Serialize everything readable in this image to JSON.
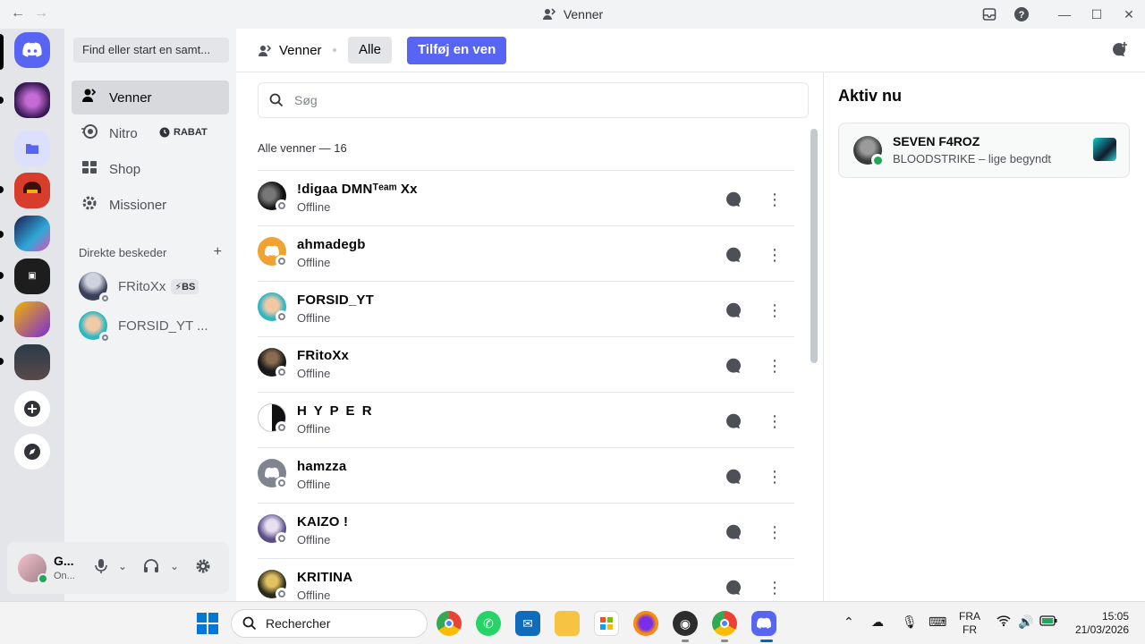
{
  "window": {
    "title": "Venner",
    "back_icon": "arrow-left-icon",
    "forward_icon": "arrow-right-icon"
  },
  "sidebar": {
    "find_placeholder": "Find eller start en samt...",
    "nav": [
      {
        "label": "Venner",
        "icon": "friends-icon",
        "active": true
      },
      {
        "label": "Nitro",
        "icon": "nitro-icon"
      },
      {
        "label": "Shop",
        "icon": "shop-icon"
      },
      {
        "label": "Missioner",
        "icon": "missions-icon"
      }
    ],
    "nitro_badge": "RABAT",
    "dm_header": "Direkte beskeder",
    "dms": [
      {
        "name": "FRitoXx",
        "badge": "BS"
      },
      {
        "name": "FORSID_YT ..."
      }
    ]
  },
  "user_panel": {
    "name": "G...",
    "status": "On..."
  },
  "topbar": {
    "venner": "Venner",
    "alle": "Alle",
    "add_friend": "Tilføj en ven"
  },
  "search": {
    "placeholder": "Søg"
  },
  "friends": {
    "count_label": "Alle venner — 16",
    "rows": [
      {
        "name": "!digaa DMNᵀᵉᵃᵐ Xx",
        "status": "Offline"
      },
      {
        "name": "ahmadegb",
        "status": "Offline"
      },
      {
        "name": "FORSID_YT",
        "status": "Offline"
      },
      {
        "name": "FRitoXx",
        "status": "Offline"
      },
      {
        "name": "H Y P E R",
        "status": "Offline"
      },
      {
        "name": "hamzza",
        "status": "Offline"
      },
      {
        "name": "KAIZO !",
        "status": "Offline"
      },
      {
        "name": "KRITINA",
        "status": "Offline"
      }
    ]
  },
  "active_now": {
    "title": "Aktiv nu",
    "name": "SEVEN F4ROZ",
    "activity": "BLOODSTRIKE – lige begyndt"
  },
  "taskbar": {
    "search": "Rechercher",
    "lang_top": "FRA",
    "lang_bottom": "FR",
    "time": "15:05",
    "date": "21/03/2026"
  },
  "colors": {
    "accent": "#5865f2",
    "online": "#23a55a",
    "offline": "#80848e"
  }
}
